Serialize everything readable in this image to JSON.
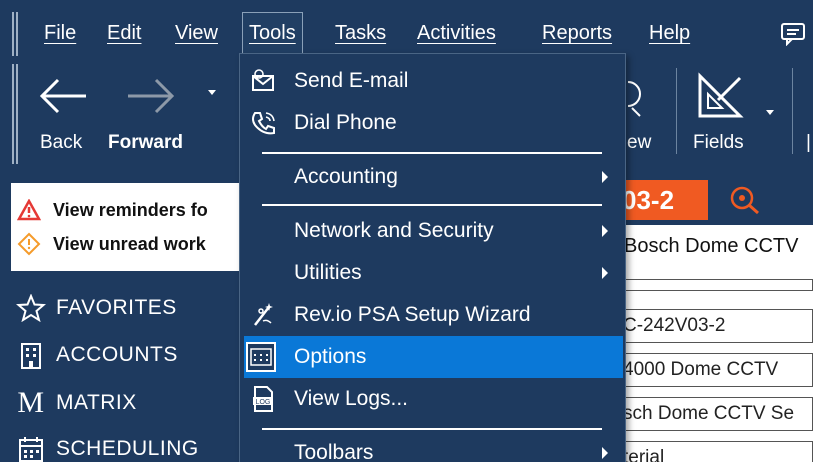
{
  "menubar": {
    "items": [
      "File",
      "Edit",
      "View",
      "Tools",
      "Tasks",
      "Activities",
      "Reports",
      "Help"
    ]
  },
  "toolbar": {
    "back": "Back",
    "forward": "Forward",
    "view_partial": "ew",
    "fields": "Fields"
  },
  "reminders": {
    "row1": "View reminders fo",
    "row2": "View unread work"
  },
  "nav": {
    "favorites": "FAVORITES",
    "accounts": "ACCOUNTS",
    "matrix": "MATRIX",
    "scheduling": "SCHEDULING"
  },
  "record": {
    "tag": "03-2",
    "title": "Bosch Dome CCTV",
    "field1": "C-242V03-2",
    "field2": "4000 Dome CCTV",
    "field3": "sch Dome CCTV Se",
    "field4": "terial"
  },
  "tools_menu": {
    "send_email": "Send E-mail",
    "dial_phone": "Dial Phone",
    "accounting": "Accounting",
    "network_security": "Network and Security",
    "utilities": "Utilities",
    "setup_wizard": "Rev.io PSA Setup Wizard",
    "options": "Options",
    "view_logs": "View Logs...",
    "toolbars": "Toolbars"
  },
  "colors": {
    "background": "#1e3a5f",
    "highlight": "#0a78d7",
    "accent": "#f05a22"
  }
}
